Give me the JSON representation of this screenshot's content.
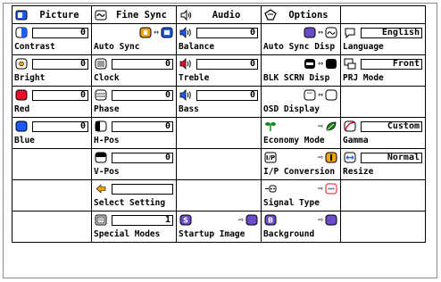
{
  "headers": [
    {
      "label": "Picture"
    },
    {
      "label": "Fine Sync"
    },
    {
      "label": "Audio"
    },
    {
      "label": "Options"
    },
    {
      "label": ""
    }
  ],
  "picture": {
    "contrast": {
      "label": "Contrast",
      "value": "0"
    },
    "bright": {
      "label": "Bright",
      "value": "0"
    },
    "red": {
      "label": "Red",
      "value": "0"
    },
    "blue": {
      "label": "Blue",
      "value": "0"
    }
  },
  "fine_sync": {
    "auto_sync": {
      "label": "Auto Sync"
    },
    "clock": {
      "label": "Clock",
      "value": "0"
    },
    "phase": {
      "label": "Phase",
      "value": "0"
    },
    "h_pos": {
      "label": "H-Pos",
      "value": "0"
    },
    "v_pos": {
      "label": "V-Pos",
      "value": "0"
    },
    "select_setting": {
      "label": "Select Setting",
      "value": ""
    },
    "special_modes": {
      "label": "Special Modes",
      "value": "1"
    }
  },
  "audio": {
    "balance": {
      "label": "Balance",
      "value": "0"
    },
    "treble": {
      "label": "Treble",
      "value": "0"
    },
    "bass": {
      "label": "Bass",
      "value": "0"
    },
    "startup_image": {
      "label": "Startup Image"
    }
  },
  "options": {
    "auto_sync_disp": {
      "label": "Auto Sync Disp"
    },
    "blk_scrn_disp": {
      "label": "BLK SCRN Disp"
    },
    "osd_display": {
      "label": "OSD Display"
    },
    "economy_mode": {
      "label": "Economy Mode"
    },
    "ip_conversion": {
      "label": "I/P Conversion"
    },
    "signal_type": {
      "label": "Signal Type"
    },
    "background": {
      "label": "Background"
    }
  },
  "extra": {
    "language": {
      "label": "Language",
      "value": "English"
    },
    "prj_mode": {
      "label": "PRJ Mode",
      "value": "Front"
    },
    "gamma": {
      "label": "Gamma",
      "value": "Custom"
    },
    "resize": {
      "label": "Resize",
      "value": "Normal"
    }
  },
  "colors": {
    "blue": "#1a5cff",
    "red": "#e8102a",
    "orange": "#f2a400",
    "green": "#1a8a1a",
    "purple": "#6a4cc8"
  }
}
